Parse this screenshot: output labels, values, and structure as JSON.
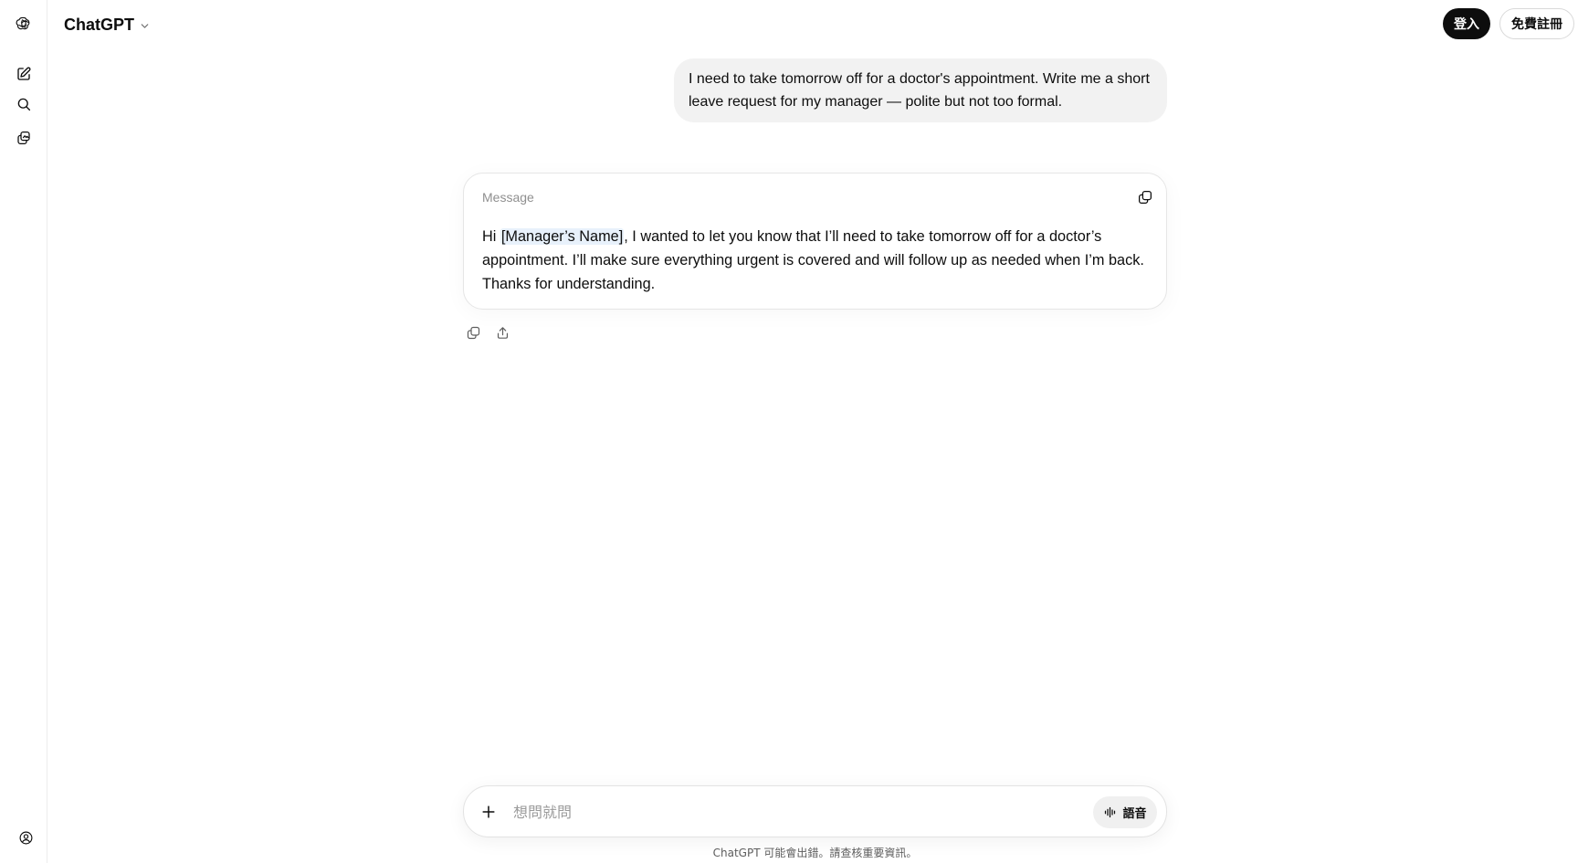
{
  "header": {
    "model_name": "ChatGPT",
    "login_label": "登入",
    "signup_label": "免費註冊"
  },
  "sidebar": {
    "icons": [
      "openai-logo-icon",
      "new-chat-icon",
      "search-icon",
      "library-icon",
      "profile-settings-icon"
    ]
  },
  "conversation": {
    "user_message": "I need to take tomorrow off for a doctor's appointment. Write me a short leave request for my manager — polite but not too formal.",
    "assistant_card": {
      "label": "Message",
      "body_prefix": "Hi ",
      "placeholder": "[Manager’s Name]",
      "body_suffix": ", I wanted to let you know that I’ll need to take tomorrow off for a doctor’s appointment. I’ll make sure everything urgent is covered and will follow up as needed when I’m back. Thanks for understanding."
    }
  },
  "composer": {
    "placeholder": "想問就問",
    "voice_label": "語音"
  },
  "footer": {
    "disclaimer": "ChatGPT 可能會出錯。請查核重要資訊。"
  },
  "colors": {
    "accent": "#0d0d0d",
    "user_bubble_bg": "#f2f2f2",
    "placeholder_highlight": "#e8f1fb"
  }
}
